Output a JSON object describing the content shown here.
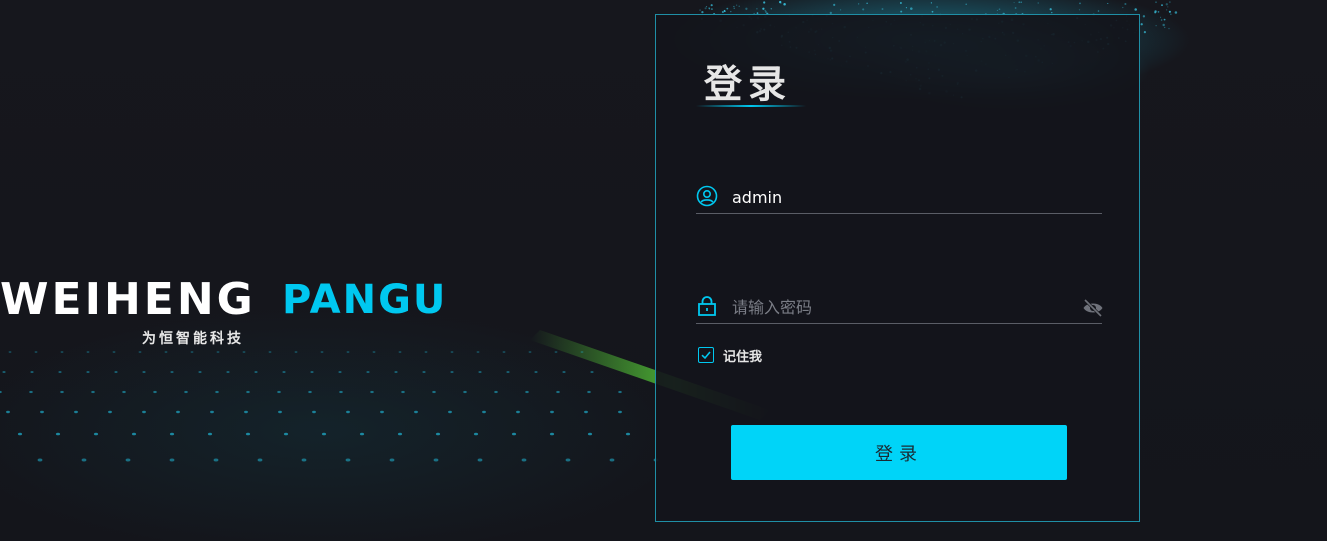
{
  "brand": {
    "logo_text": "WEIHENG",
    "product_name": "PANGU",
    "subtitle": "为恒智能科技"
  },
  "login": {
    "title": "登录",
    "username": {
      "value": "admin",
      "icon": "user-circle-icon"
    },
    "password": {
      "value": "",
      "placeholder": "请输入密码",
      "icon": "lock-icon",
      "toggle_icon": "eye-off-icon"
    },
    "remember": {
      "label": "记住我",
      "checked": true
    },
    "submit_label": "登录"
  },
  "colors": {
    "accent": "#00c8f0",
    "button": "#00d4f8",
    "background": "#15161c",
    "panel_border": "#1f8fa6",
    "green_glow": "#5ad63a"
  }
}
